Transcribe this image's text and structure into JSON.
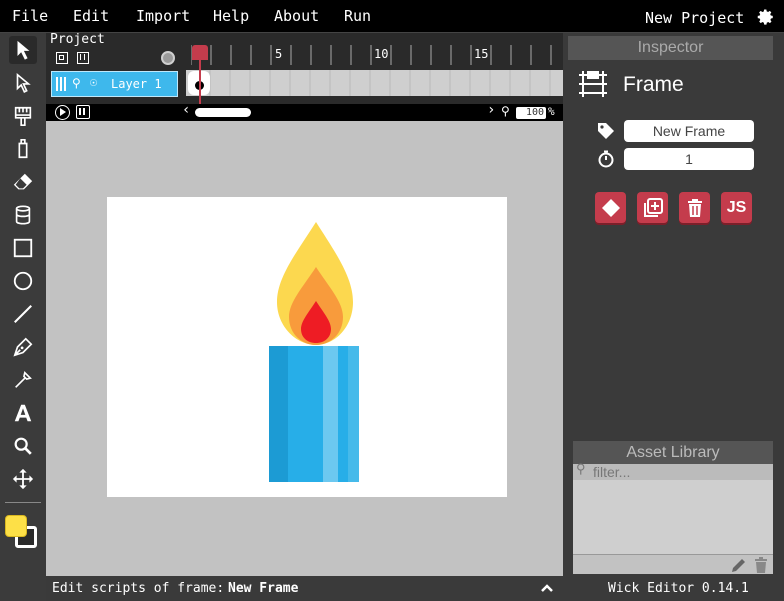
{
  "menubar": {
    "items": [
      "File",
      "Edit",
      "Import",
      "Help",
      "About",
      "Run"
    ],
    "project_name": "New Project"
  },
  "timeline": {
    "header": "Project",
    "ruler_labels": [
      "5",
      "10",
      "15"
    ],
    "layer_name": "Layer 1",
    "zoom": "100",
    "zoom_unit": "%"
  },
  "status": {
    "prefix": "Edit scripts of frame:",
    "frame_name": "New Frame"
  },
  "inspector": {
    "title": "Inspector",
    "selection_type": "Frame",
    "name_value": "New Frame",
    "duration_value": "1",
    "js_label": "JS"
  },
  "asset_library": {
    "title": "Asset Library",
    "filter_placeholder": "filter..."
  },
  "version": "Wick Editor 0.14.1",
  "colors": {
    "fill": "#fde047",
    "stroke": "#ffffff",
    "accent": "#c43c4c",
    "layer": "#3eb8ec"
  },
  "icons": [
    "select-icon",
    "path-select-icon",
    "brush-icon",
    "pencil-icon",
    "eraser-icon",
    "fill-bucket-icon",
    "rectangle-icon",
    "ellipse-icon",
    "line-icon",
    "pen-icon",
    "eyedropper-icon",
    "text-icon",
    "zoom-icon",
    "pan-icon"
  ]
}
